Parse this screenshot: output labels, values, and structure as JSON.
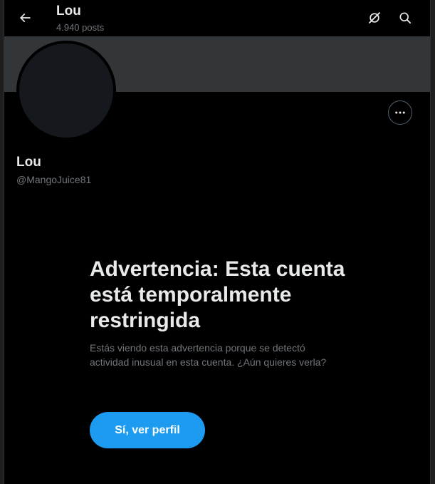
{
  "header": {
    "title": "Lou",
    "post_count": "4.940 posts",
    "icons": [
      "back-arrow-icon",
      "grok-icon",
      "search-icon"
    ]
  },
  "profile": {
    "name": "Lou",
    "handle": "@MangoJuice81"
  },
  "warning": {
    "title": "Advertencia: Esta cuenta está temporalmente restringida",
    "body": "Estás viendo esta advertencia porque se detectó actividad inusual en esta cuenta. ¿Aún quieres verla?",
    "button_label": "Sí, ver perfil"
  },
  "colors": {
    "background": "#000000",
    "banner": "#333639",
    "accent": "#1d9bf0",
    "text_primary": "#e7e9ea",
    "text_secondary": "#71767b"
  }
}
